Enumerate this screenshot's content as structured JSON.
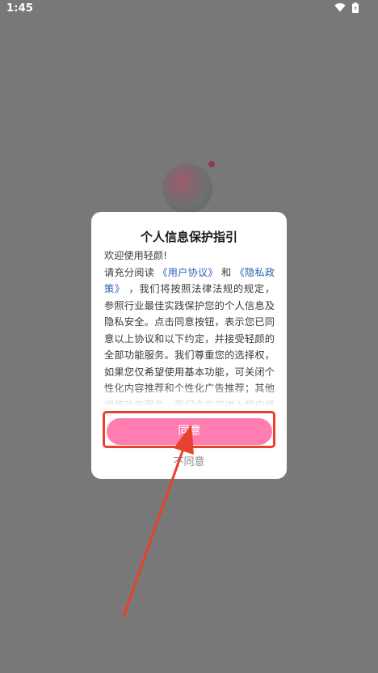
{
  "status_bar": {
    "time": "1:45"
  },
  "dialog": {
    "title": "个人信息保护指引",
    "greeting": "欢迎使用轻颜!",
    "body": {
      "prefix": "请充分阅读",
      "link_user_agreement": "《用户协议》",
      "conjunction": "和",
      "link_privacy_policy": "《隐私政策》",
      "text": "，我们将按照法律法规的规定，参照行业最佳实践保护您的个人信息及隐私安全。点击同意按钮，表示您已同意以上协议和以下约定，并接受轻颜的全部功能服务。我们尊重您的选择权，如果您仅希望使用基本功能，可关闭个性化内容推荐和个性化广告推荐；其他增值功能服务，我们会在您进入相应模块时进行单独告知，并仅在获得授权",
      "link_color": "#2f63b4"
    },
    "agree_label": "同意",
    "disagree_label": "不同意",
    "agree_color": "#ff7db0"
  },
  "annotation": {
    "color": "#e8412d"
  }
}
